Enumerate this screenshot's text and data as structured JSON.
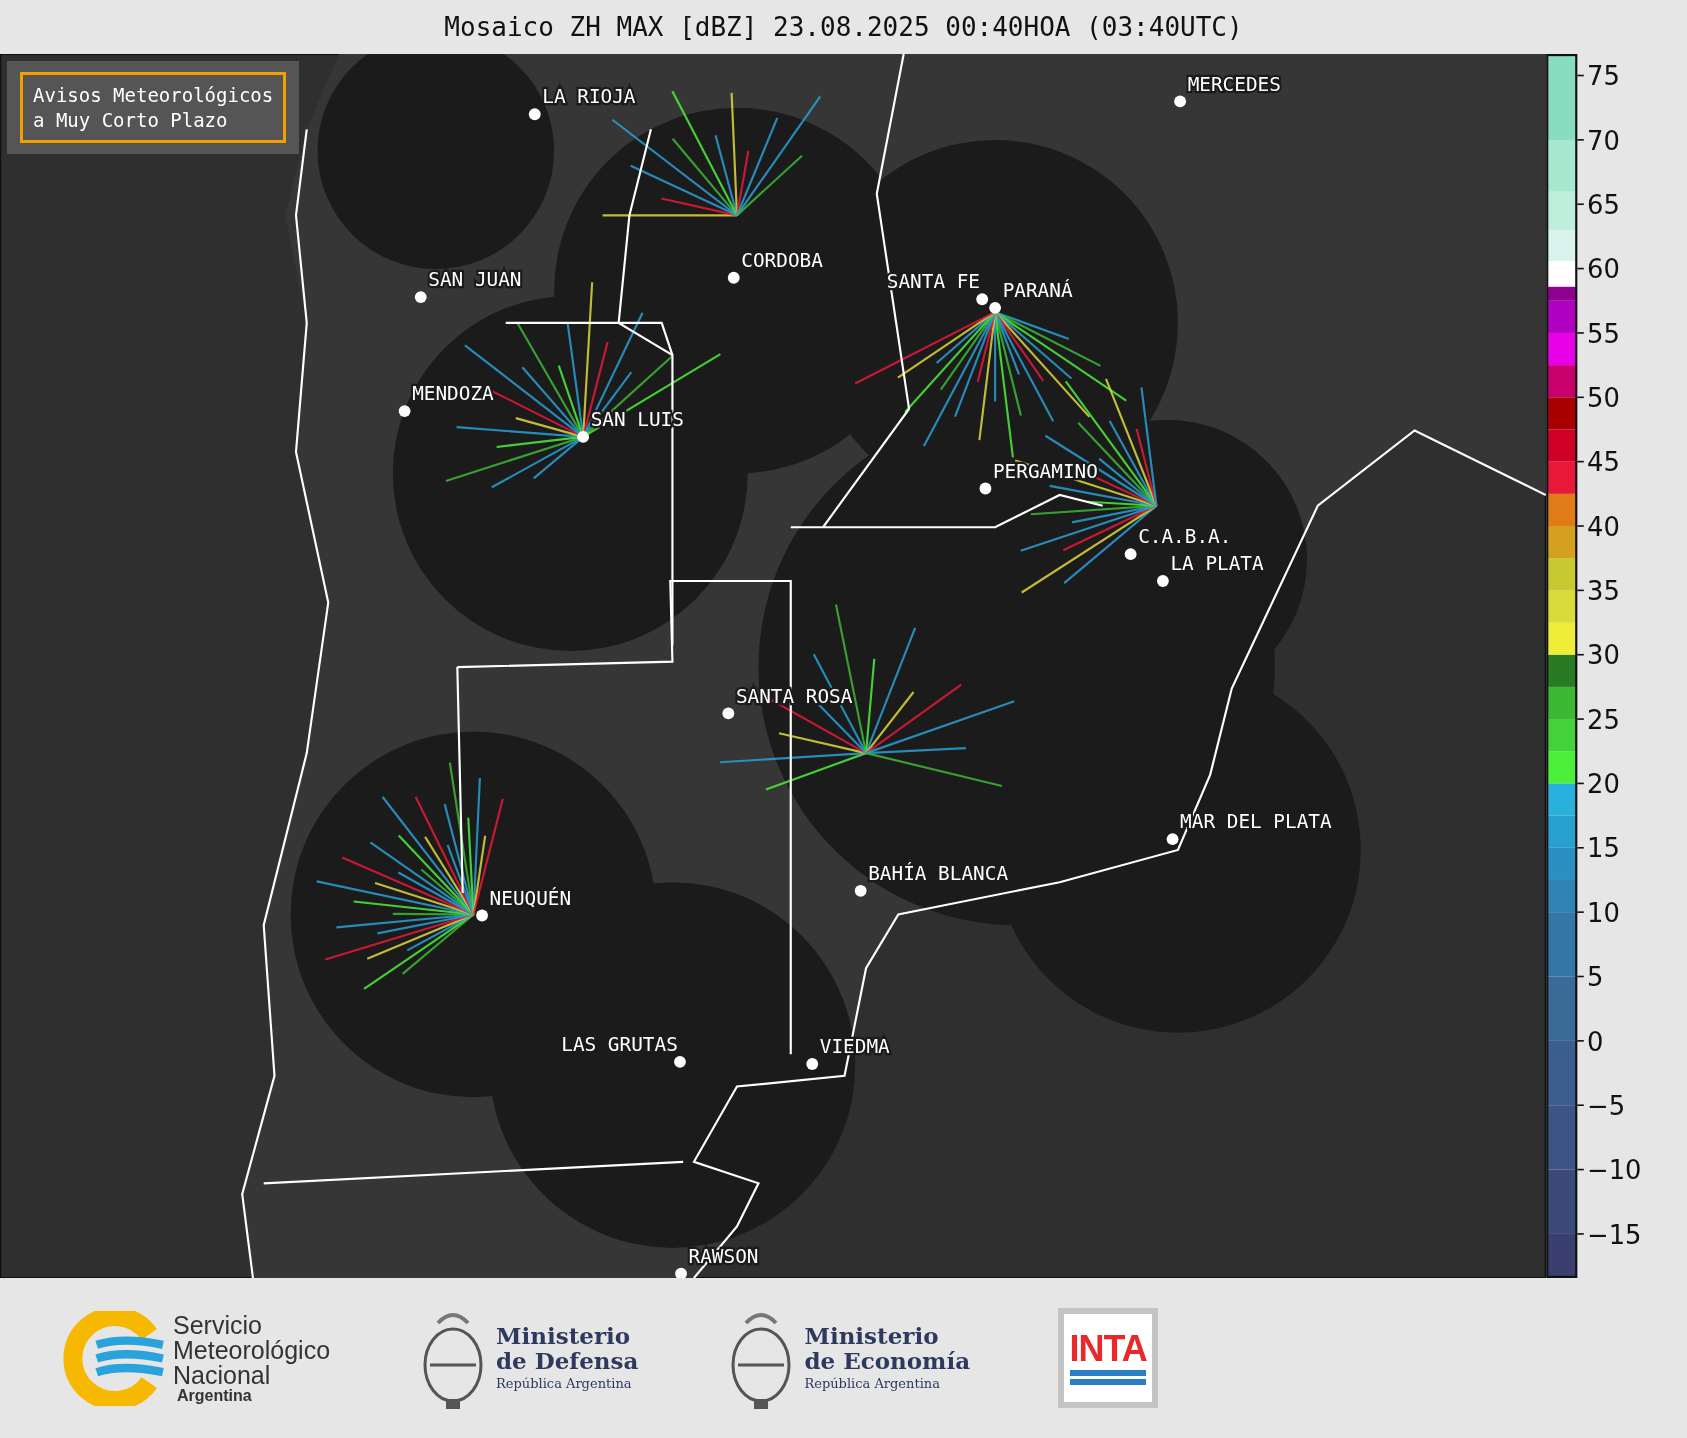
{
  "title": "Mosaico ZH MAX [dBZ] 23.08.2025 00:40HOA (03:40UTC)",
  "legend": {
    "text": "Avisos Meteorológicos\na Muy Corto Plazo"
  },
  "cities": [
    {
      "name": "LA RIOJA"
    },
    {
      "name": "SAN JUAN"
    },
    {
      "name": "CORDOBA"
    },
    {
      "name": "SANTA FE"
    },
    {
      "name": "PARANÁ"
    },
    {
      "name": "MENDOZA"
    },
    {
      "name": "SAN LUIS"
    },
    {
      "name": "PERGAMINO"
    },
    {
      "name": "MERCEDES"
    },
    {
      "name": "C.A.B.A."
    },
    {
      "name": "LA PLATA"
    },
    {
      "name": "SANTA ROSA"
    },
    {
      "name": "MAR DEL PLATA"
    },
    {
      "name": "BAHÍA BLANCA"
    },
    {
      "name": "NEUQUÉN"
    },
    {
      "name": "LAS GRUTAS"
    },
    {
      "name": "VIEDMA"
    },
    {
      "name": "RAWSON"
    }
  ],
  "colorbar": {
    "ticks": [
      "75",
      "70",
      "65",
      "60",
      "55",
      "50",
      "45",
      "40",
      "35",
      "30",
      "25",
      "20",
      "15",
      "10",
      "5",
      "0",
      "−5",
      "−10",
      "−15"
    ]
  },
  "logos": [
    {
      "kind": "smn",
      "lines": [
        "Servicio",
        "Meteorológico",
        "Nacional"
      ],
      "sub": "Argentina"
    },
    {
      "kind": "ministry",
      "lines": [
        "Ministerio",
        "de Defensa"
      ],
      "sub": "República Argentina"
    },
    {
      "kind": "ministry",
      "lines": [
        "Ministerio",
        "de Economía"
      ],
      "sub": "República Argentina"
    },
    {
      "kind": "inta",
      "lines": [
        "INTA"
      ]
    }
  ]
}
